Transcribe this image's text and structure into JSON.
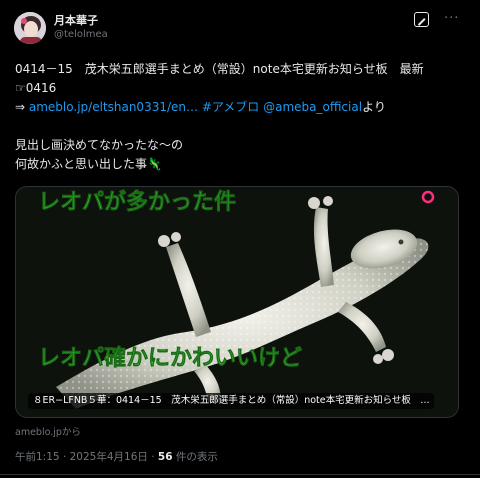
{
  "author": {
    "display_name": "月本華子",
    "handle": "@telolmea"
  },
  "tweet": {
    "line1": "0414－15　茂木栄五郎選手まとめ（常設）note本宅更新お知らせ板　最新",
    "line2": "☞0416",
    "line3_prefix": "⇒ ",
    "line3_link": "ameblo.jp/eltshan0331/en…",
    "line3_hashtag": " #アメブロ",
    "line3_mention": " @ameba_official",
    "line3_suffix": "より",
    "line5": "見出し画決めてなかったな～の",
    "line6": "何故かふと思い出した事🦎"
  },
  "card": {
    "image_text_top": "レオパが多かった件",
    "image_text_middle": "レオパ確かにかわいいけど",
    "overlay_title": "８ER−LFNB５華：0414－15　茂木栄五郎選手まとめ（常設）note本宅更新お知らせ板　...",
    "source": "ameblo.jpから"
  },
  "meta": {
    "time": "午前1:15",
    "separator1": " · ",
    "date": "2025年4月16日",
    "separator2": " · ",
    "views_count": "56",
    "views_label": " 件の表示"
  },
  "colors": {
    "background": "#000000",
    "link": "#1d9bf0",
    "secondary_text": "#71767b",
    "image_text_green": "#3ddc3a",
    "pink_mark": "#ff2e7e"
  },
  "icons": [
    "grok-icon",
    "more-icon"
  ]
}
